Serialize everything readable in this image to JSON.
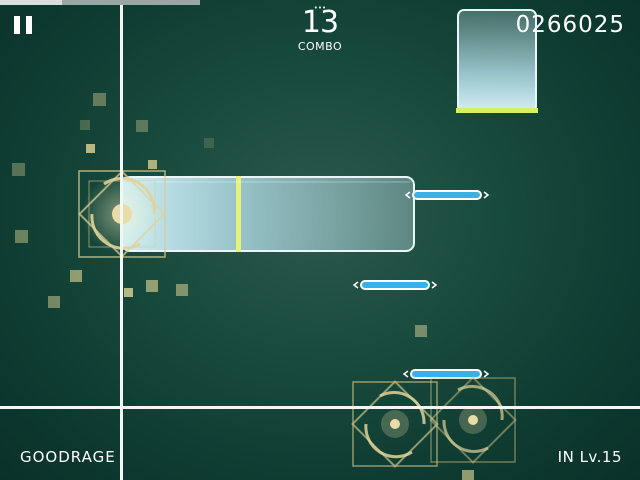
{
  "hud": {
    "combo_count": "13",
    "combo_label": "COMBO",
    "combo_dots": "•••",
    "score": "0266025",
    "player_name": "GOODRAGE",
    "difficulty_level": "IN  Lv.15",
    "song_progress": 0.31
  },
  "icons": {
    "pause": "pause-icon"
  },
  "colors": {
    "background": "#0d3b32",
    "line": "#f2f6f4",
    "note_blue": "#3ab0e8",
    "judge_gold": "#e8d9a0",
    "hold_glow": "#d8f060"
  }
}
